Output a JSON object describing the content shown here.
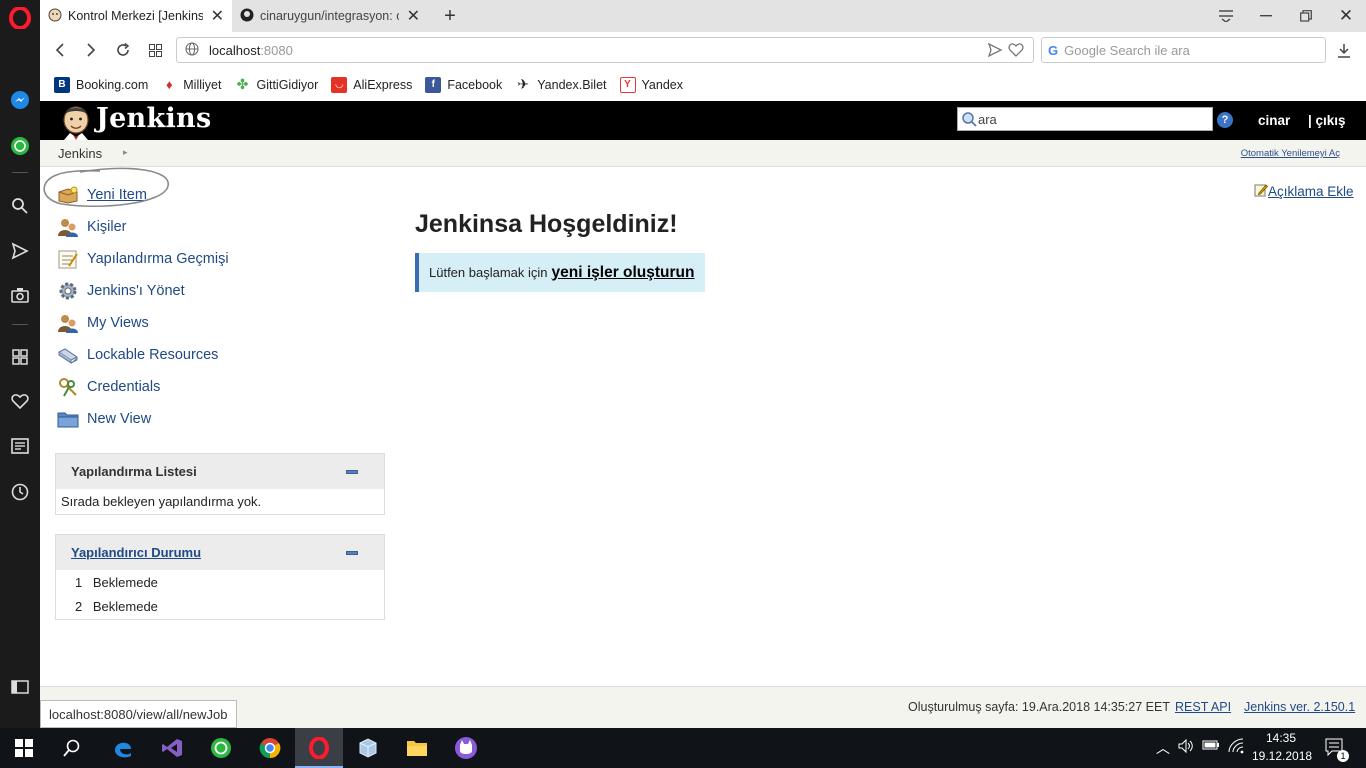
{
  "browser": {
    "tabs": [
      {
        "title": "Kontrol Merkezi [Jenkins]",
        "active": true
      },
      {
        "title": "cinaruygun/integrasyon: o",
        "active": false
      }
    ],
    "url_host": "localhost",
    "url_port": ":8080",
    "search_placeholder": "Google Search ile ara",
    "bookmarks": [
      "Booking.com",
      "Milliyet",
      "GittiGidiyor",
      "AliExpress",
      "Facebook",
      "Yandex.Bilet",
      "Yandex"
    ],
    "status_url": "localhost:8080/view/all/newJob"
  },
  "header": {
    "logo_text": "Jenkins",
    "search_value": "ara",
    "help_label": "?",
    "user": "cinar",
    "logout": "| çıkış"
  },
  "breadcrumb": {
    "root": "Jenkins",
    "auto_refresh": "Otomatik Yenilemeyi Aç"
  },
  "tasks": [
    {
      "label": "Yeni Item",
      "icon": "new-item-icon"
    },
    {
      "label": "Kişiler",
      "icon": "people-icon"
    },
    {
      "label": "Yapılandırma Geçmişi",
      "icon": "build-history-icon"
    },
    {
      "label": "Jenkins'ı Yönet",
      "icon": "manage-gear-icon"
    },
    {
      "label": "My Views",
      "icon": "my-views-icon"
    },
    {
      "label": "Lockable Resources",
      "icon": "lockable-resources-icon"
    },
    {
      "label": "Credentials",
      "icon": "credentials-icon"
    },
    {
      "label": "New View",
      "icon": "folder-icon"
    }
  ],
  "build_queue": {
    "title": "Yapılandırma Listesi",
    "empty_text": "Sırada bekleyen yapılandırma yok."
  },
  "executors": {
    "title": "Yapılandırıcı Durumu",
    "rows": [
      {
        "num": "1",
        "status": "Beklemede"
      },
      {
        "num": "2",
        "status": "Beklemede"
      }
    ]
  },
  "main": {
    "welcome": "Jenkinsa Hoşgeldiniz!",
    "notice_prefix": "Lütfen başlamak için",
    "notice_link": "yeni işler oluşturun",
    "add_description": "Açıklama Ekle"
  },
  "footer": {
    "generated": "Oluşturulmuş sayfa: 19.Ara.2018 14:35:27 EET",
    "rest_api": "REST API",
    "version": "Jenkins ver. 2.150.1"
  },
  "taskbar": {
    "time": "14:35",
    "date": "19.12.2018",
    "notifications": "1"
  }
}
